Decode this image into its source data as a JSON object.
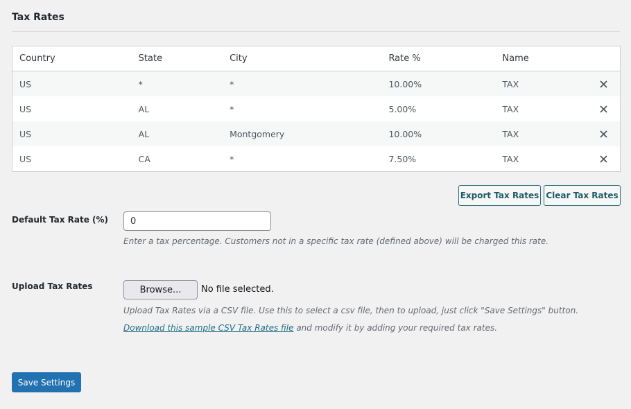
{
  "section": {
    "title": "Tax Rates"
  },
  "table": {
    "headers": [
      "Country",
      "State",
      "City",
      "Rate %",
      "Name"
    ],
    "rows": [
      {
        "country": "US",
        "state": "*",
        "city": "*",
        "rate": "10.00%",
        "name": "TAX"
      },
      {
        "country": "US",
        "state": "AL",
        "city": "*",
        "rate": "5.00%",
        "name": "TAX"
      },
      {
        "country": "US",
        "state": "AL",
        "city": "Montgomery",
        "rate": "10.00%",
        "name": "TAX"
      },
      {
        "country": "US",
        "state": "CA",
        "city": "*",
        "rate": "7.50%",
        "name": "TAX"
      }
    ]
  },
  "actions": {
    "export_label": "Export Tax Rates",
    "clear_label": "Clear Tax Rates"
  },
  "default_rate": {
    "label": "Default Tax Rate (%)",
    "value": "0",
    "description": "Enter a tax percentage. Customers not in a specific tax rate (defined above) will be charged this rate."
  },
  "upload": {
    "label": "Upload Tax Rates",
    "browse_label": "Browse...",
    "file_status": "No file selected.",
    "description": "Upload Tax Rates via a CSV file. Use this to select a csv file, then to upload, just click \"Save Settings\" button.",
    "sample_link": "Download this sample CSV Tax Rates file",
    "sample_suffix": " and modify it by adding your required tax rates."
  },
  "save_label": "Save Settings",
  "colors": {
    "primary": "#2271b1",
    "background": "#f1f1f1",
    "outline_button": "#1d5a66"
  },
  "icons": {
    "row_delete": "close-icon"
  }
}
